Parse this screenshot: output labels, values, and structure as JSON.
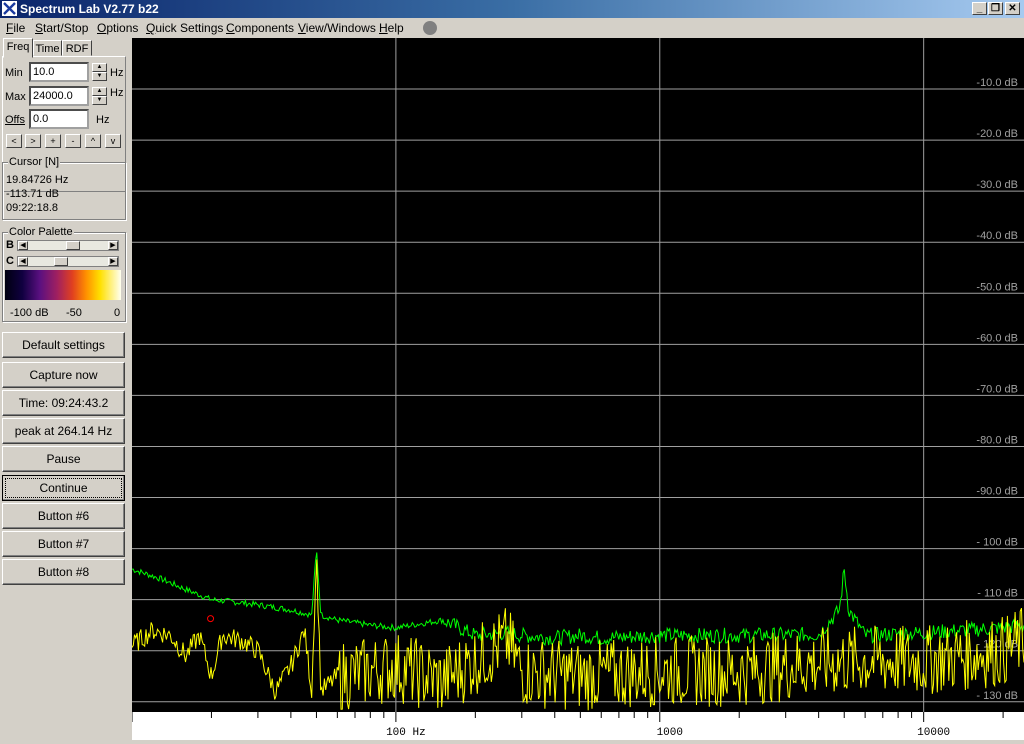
{
  "window": {
    "title": "Spectrum Lab V2.77 b22"
  },
  "menu": [
    "File",
    "Start/Stop",
    "Options",
    "Quick Settings",
    "Components",
    "View/Windows",
    "Help"
  ],
  "tabs": [
    "Freq",
    "Time",
    "RDF"
  ],
  "freq": {
    "min_label": "Min",
    "min_value": "10.0",
    "min_unit": "Hz",
    "max_label": "Max",
    "max_value": "24000.0",
    "max_unit": "Hz",
    "offs_label": "Offs",
    "offs_value": "0.0",
    "offs_unit": "Hz",
    "nav_buttons": [
      "<",
      ">",
      "+",
      "-",
      "^",
      "v"
    ]
  },
  "cursor": {
    "title": "Cursor [N]",
    "freq": "19.84726 Hz",
    "level": "-113.71 dB",
    "time": "09:22:18.8"
  },
  "palette": {
    "title": "Color Palette",
    "b_label": "B",
    "c_label": "C",
    "scale": [
      "-100 dB",
      "-50",
      "0"
    ]
  },
  "buttons": [
    "Default settings",
    "Capture now",
    "Time:  09:24:43.2",
    "peak at 264.14 Hz",
    "Pause",
    "Continue",
    "Button #6",
    "Button #7",
    "Button #8"
  ],
  "chart_data": {
    "type": "line",
    "x_scale": "log",
    "xlim": [
      10,
      24000
    ],
    "ylim": [
      -132,
      0
    ],
    "y_ticks": [
      "-10.0 dB",
      "-20.0 dB",
      "-30.0 dB",
      "-40.0 dB",
      "-50.0 dB",
      "-60.0 dB",
      "-70.0 dB",
      "-80.0 dB",
      "-90.0 dB",
      "- 100 dB",
      "- 110 dB",
      "- 120 dB",
      "- 130 dB"
    ],
    "x_tick_labels": [
      "100  Hz",
      "1000",
      "10000"
    ],
    "grid": true,
    "series": [
      {
        "color": "#00ff00",
        "kind": "average",
        "points": [
          [
            10,
            -104
          ],
          [
            13,
            -106
          ],
          [
            16,
            -108
          ],
          [
            20,
            -110
          ],
          [
            25,
            -110.5
          ],
          [
            30,
            -111
          ],
          [
            40,
            -112
          ],
          [
            48,
            -113
          ],
          [
            50,
            -100
          ],
          [
            52,
            -113
          ],
          [
            60,
            -114
          ],
          [
            80,
            -115
          ],
          [
            100,
            -115.5
          ],
          [
            150,
            -114
          ],
          [
            200,
            -117
          ],
          [
            264,
            -116.5
          ],
          [
            300,
            -117
          ],
          [
            400,
            -117.5
          ],
          [
            500,
            -117
          ],
          [
            600,
            -117.5
          ],
          [
            1000,
            -117
          ],
          [
            2000,
            -117
          ],
          [
            4000,
            -116.8
          ],
          [
            4800,
            -112
          ],
          [
            5000,
            -104
          ],
          [
            5200,
            -112
          ],
          [
            6000,
            -117
          ],
          [
            10000,
            -116.5
          ],
          [
            20000,
            -115.5
          ],
          [
            24000,
            -115
          ]
        ]
      },
      {
        "color": "#ffff00",
        "kind": "instant",
        "points": [
          [
            10,
            -119
          ],
          [
            12,
            -116
          ],
          [
            14,
            -117
          ],
          [
            16,
            -121
          ],
          [
            18,
            -117
          ],
          [
            20,
            -125
          ],
          [
            22,
            -117
          ],
          [
            26,
            -118
          ],
          [
            30,
            -120
          ],
          [
            35,
            -128
          ],
          [
            40,
            -123
          ],
          [
            45,
            -116
          ],
          [
            48,
            -128
          ],
          [
            50,
            -101
          ],
          [
            52,
            -128
          ],
          [
            60,
            -125
          ],
          [
            80,
            -124
          ],
          [
            100,
            -123
          ],
          [
            150,
            -126
          ],
          [
            264,
            -118
          ],
          [
            300,
            -124
          ],
          [
            500,
            -125
          ],
          [
            1000,
            -124
          ],
          [
            2000,
            -124
          ],
          [
            3000,
            -123
          ],
          [
            5000,
            -122
          ],
          [
            10000,
            -122
          ],
          [
            20000,
            -120
          ],
          [
            24000,
            -118
          ]
        ]
      }
    ],
    "marker": {
      "freq": 19.84726,
      "level": -113.71,
      "color": "#ff0000"
    }
  }
}
